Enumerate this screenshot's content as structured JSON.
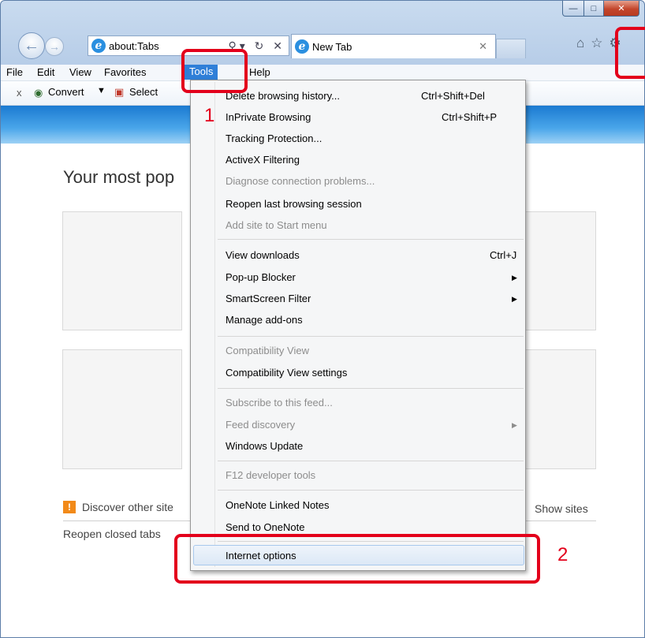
{
  "browser": {
    "address": "about:Tabs",
    "tab_title": "New Tab"
  },
  "menubar": [
    "File",
    "Edit",
    "View",
    "Favorites",
    "Tools",
    "Help"
  ],
  "commandbar": {
    "convert": "Convert",
    "select": "Select"
  },
  "page": {
    "heading": "Your most pop",
    "discover": "Discover other site",
    "show_sites": "Show sites",
    "reopen": "Reopen closed tabs"
  },
  "tools_menu": {
    "items": [
      {
        "label": "Delete browsing history...",
        "shortcut": "Ctrl+Shift+Del",
        "disabled": false
      },
      {
        "label": "InPrivate Browsing",
        "shortcut": "Ctrl+Shift+P",
        "disabled": false
      },
      {
        "label": "Tracking Protection...",
        "disabled": false
      },
      {
        "label": "ActiveX Filtering",
        "disabled": false
      },
      {
        "label": "Diagnose connection problems...",
        "disabled": true
      },
      {
        "label": "Reopen last browsing session",
        "disabled": false
      },
      {
        "label": "Add site to Start menu",
        "disabled": true
      },
      {
        "label": "View downloads",
        "shortcut": "Ctrl+J",
        "disabled": false
      },
      {
        "label": "Pop-up Blocker",
        "submenu": true,
        "disabled": false
      },
      {
        "label": "SmartScreen Filter",
        "submenu": true,
        "disabled": false
      },
      {
        "label": "Manage add-ons",
        "disabled": false
      },
      {
        "label": "Compatibility View",
        "disabled": true
      },
      {
        "label": "Compatibility View settings",
        "disabled": false
      },
      {
        "label": "Subscribe to this feed...",
        "disabled": true
      },
      {
        "label": "Feed discovery",
        "submenu": true,
        "disabled": true
      },
      {
        "label": "Windows Update",
        "disabled": false
      },
      {
        "label": "F12 developer tools",
        "disabled": true
      },
      {
        "label": "OneNote Linked Notes",
        "disabled": false
      },
      {
        "label": "Send to OneNote",
        "disabled": false
      },
      {
        "label": "Internet options",
        "disabled": false,
        "highlighted": true
      }
    ]
  },
  "annotations": {
    "step1": "1",
    "step2": "2"
  },
  "colors": {
    "annotation": "#e3001b",
    "menu_highlight": "#2f7fd8"
  }
}
